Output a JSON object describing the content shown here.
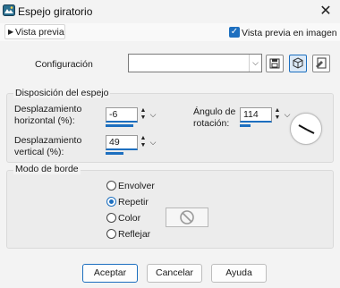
{
  "window": {
    "title": "Espejo giratorio",
    "close_symbol": "✕"
  },
  "preview": {
    "toggle_label": "Vista previa",
    "image_preview_label": "Vista previa en imagen",
    "image_preview_checked": true
  },
  "config": {
    "label": "Configuración",
    "value": ""
  },
  "mirror": {
    "title": "Disposición del espejo",
    "horizontal_label_1": "Desplazamiento",
    "horizontal_label_2": "horizontal (%):",
    "horizontal_value": "-6",
    "vertical_label_1": "Desplazamiento",
    "vertical_label_2": "vertical (%):",
    "vertical_value": "49",
    "angle_label_1": "Ángulo de",
    "angle_label_2": "rotación:",
    "angle_value": "114"
  },
  "border": {
    "title": "Modo de borde",
    "options": [
      "Envolver",
      "Repetir",
      "Color",
      "Reflejar"
    ],
    "selected": "Repetir"
  },
  "buttons": {
    "ok": "Aceptar",
    "cancel": "Cancelar",
    "help": "Ayuda"
  },
  "colors": {
    "accent": "#1d6fbf"
  },
  "icons": [
    "app-mirror-icon",
    "close-icon",
    "disclosure-triangle-icon",
    "checkbox-checked-icon",
    "save-icon",
    "preset-manager-icon",
    "reset-icon",
    "dial-icon",
    "no-color-icon"
  ]
}
